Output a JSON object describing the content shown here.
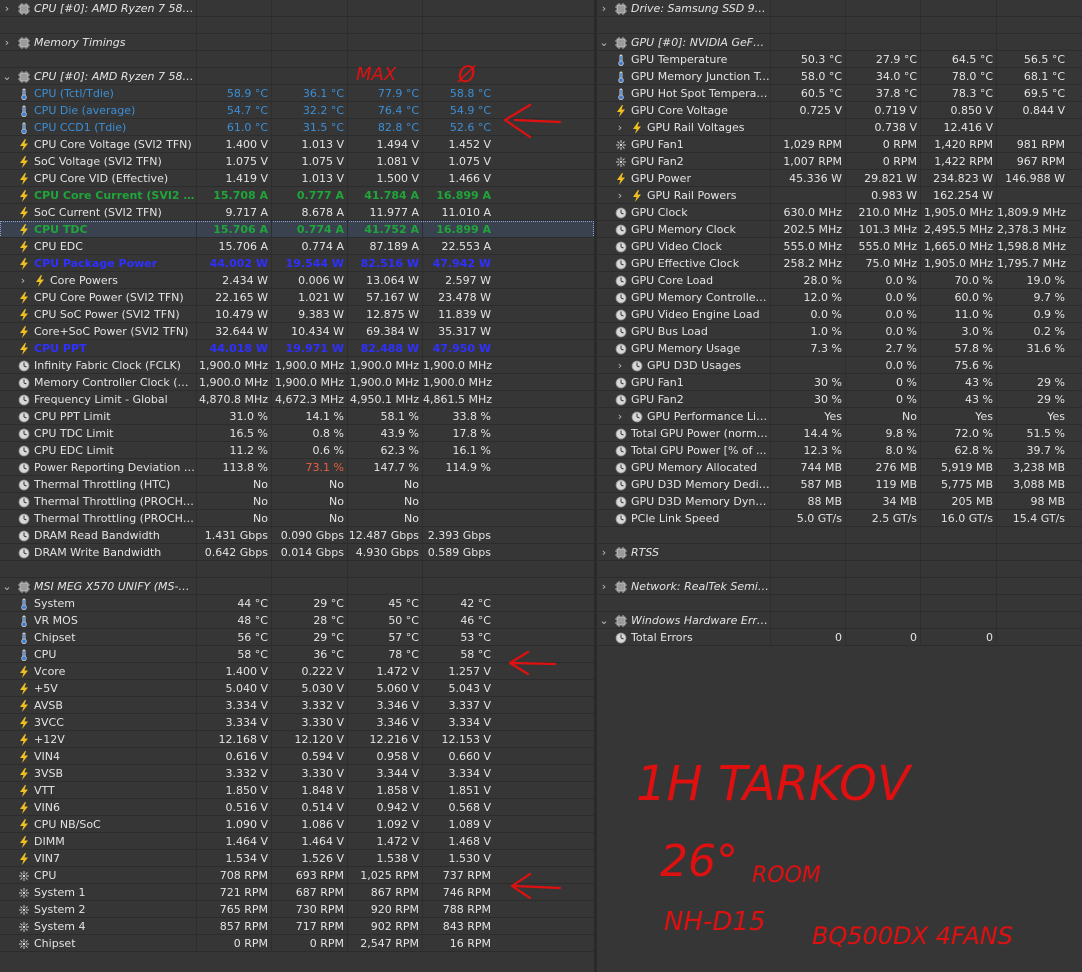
{
  "left": {
    "rows": [
      {
        "t": "grp",
        "exp": "›",
        "label": "CPU [#0]: AMD Ryzen 7 5800..."
      },
      {
        "t": "blank"
      },
      {
        "t": "grp",
        "exp": "›",
        "label": "Memory Timings"
      },
      {
        "t": "blank"
      },
      {
        "t": "grp",
        "exp": "⌄",
        "label": "CPU [#0]: AMD Ryzen 7 5800..."
      },
      {
        "t": "s",
        "i": "temp",
        "label": "CPU (Tctl/Tdie)",
        "v": [
          "58.9 °C",
          "36.1 °C",
          "77.9 °C",
          "58.8 °C"
        ],
        "cls": "t-blue"
      },
      {
        "t": "s",
        "i": "temp",
        "label": "CPU Die (average)",
        "v": [
          "54.7 °C",
          "32.2 °C",
          "76.4 °C",
          "54.9 °C"
        ],
        "cls": "t-blue"
      },
      {
        "t": "s",
        "i": "temp",
        "label": "CPU CCD1 (Tdie)",
        "v": [
          "61.0 °C",
          "31.5 °C",
          "82.8 °C",
          "52.6 °C"
        ],
        "cls": "t-blue"
      },
      {
        "t": "s",
        "i": "bolt",
        "label": "CPU Core Voltage (SVI2 TFN)",
        "v": [
          "1.400 V",
          "1.013 V",
          "1.494 V",
          "1.452 V"
        ]
      },
      {
        "t": "s",
        "i": "bolt",
        "label": "SoC Voltage (SVI2 TFN)",
        "v": [
          "1.075 V",
          "1.075 V",
          "1.081 V",
          "1.075 V"
        ]
      },
      {
        "t": "s",
        "i": "bolt",
        "label": "CPU Core VID (Effective)",
        "v": [
          "1.419 V",
          "1.013 V",
          "1.500 V",
          "1.466 V"
        ]
      },
      {
        "t": "s",
        "i": "bolt",
        "label": "CPU Core Current (SVI2 TFN)",
        "v": [
          "15.708 A",
          "0.777 A",
          "41.784 A",
          "16.899 A"
        ],
        "cls": "t-green"
      },
      {
        "t": "s",
        "i": "bolt",
        "label": "SoC Current (SVI2 TFN)",
        "v": [
          "9.717 A",
          "8.678 A",
          "11.977 A",
          "11.010 A"
        ]
      },
      {
        "t": "s",
        "i": "bolt",
        "label": "CPU TDC",
        "v": [
          "15.706 A",
          "0.774 A",
          "41.752 A",
          "16.899 A"
        ],
        "cls": "t-green",
        "sel": true
      },
      {
        "t": "s",
        "i": "bolt",
        "label": "CPU EDC",
        "v": [
          "15.706 A",
          "0.774 A",
          "87.189 A",
          "22.553 A"
        ]
      },
      {
        "t": "s",
        "i": "bolt",
        "label": "CPU Package Power",
        "v": [
          "44.002 W",
          "19.544 W",
          "82.516 W",
          "47.942 W"
        ],
        "cls": "t-navy"
      },
      {
        "t": "s",
        "exp": "›",
        "i": "bolt",
        "label": "Core Powers",
        "v": [
          "2.434 W",
          "0.006 W",
          "13.064 W",
          "2.597 W"
        ],
        "ind": 1
      },
      {
        "t": "s",
        "i": "bolt",
        "label": "CPU Core Power (SVI2 TFN)",
        "v": [
          "22.165 W",
          "1.021 W",
          "57.167 W",
          "23.478 W"
        ]
      },
      {
        "t": "s",
        "i": "bolt",
        "label": "CPU SoC Power (SVI2 TFN)",
        "v": [
          "10.479 W",
          "9.383 W",
          "12.875 W",
          "11.839 W"
        ]
      },
      {
        "t": "s",
        "i": "bolt",
        "label": "Core+SoC Power (SVI2 TFN)",
        "v": [
          "32.644 W",
          "10.434 W",
          "69.384 W",
          "35.317 W"
        ]
      },
      {
        "t": "s",
        "i": "bolt",
        "label": "CPU PPT",
        "v": [
          "44.018 W",
          "19.971 W",
          "82.488 W",
          "47.950 W"
        ],
        "cls": "t-navy"
      },
      {
        "t": "s",
        "i": "clock",
        "label": "Infinity Fabric Clock (FCLK)",
        "v": [
          "1,900.0 MHz",
          "1,900.0 MHz",
          "1,900.0 MHz",
          "1,900.0 MHz"
        ]
      },
      {
        "t": "s",
        "i": "clock",
        "label": "Memory Controller Clock (UCLK)",
        "v": [
          "1,900.0 MHz",
          "1,900.0 MHz",
          "1,900.0 MHz",
          "1,900.0 MHz"
        ]
      },
      {
        "t": "s",
        "i": "clock",
        "label": "Frequency Limit - Global",
        "v": [
          "4,870.8 MHz",
          "4,672.3 MHz",
          "4,950.1 MHz",
          "4,861.5 MHz"
        ]
      },
      {
        "t": "s",
        "i": "clock",
        "label": "CPU PPT Limit",
        "v": [
          "31.0 %",
          "14.1 %",
          "58.1 %",
          "33.8 %"
        ]
      },
      {
        "t": "s",
        "i": "clock",
        "label": "CPU TDC Limit",
        "v": [
          "16.5 %",
          "0.8 %",
          "43.9 %",
          "17.8 %"
        ]
      },
      {
        "t": "s",
        "i": "clock",
        "label": "CPU EDC Limit",
        "v": [
          "11.2 %",
          "0.6 %",
          "62.3 %",
          "16.1 %"
        ]
      },
      {
        "t": "s",
        "i": "clock",
        "label": "Power Reporting Deviation (Ac...",
        "v": [
          "113.8 %",
          "73.1 %",
          "147.7 %",
          "114.9 %"
        ],
        "redcol": 1
      },
      {
        "t": "s",
        "i": "clock",
        "label": "Thermal Throttling (HTC)",
        "v": [
          "No",
          "No",
          "No",
          ""
        ]
      },
      {
        "t": "s",
        "i": "clock",
        "label": "Thermal Throttling (PROCHOT ...",
        "v": [
          "No",
          "No",
          "No",
          ""
        ]
      },
      {
        "t": "s",
        "i": "clock",
        "label": "Thermal Throttling (PROCHOT ...",
        "v": [
          "No",
          "No",
          "No",
          ""
        ]
      },
      {
        "t": "s",
        "i": "clock",
        "label": "DRAM Read Bandwidth",
        "v": [
          "1.431 Gbps",
          "0.090 Gbps",
          "12.487 Gbps",
          "2.393 Gbps"
        ]
      },
      {
        "t": "s",
        "i": "clock",
        "label": "DRAM Write Bandwidth",
        "v": [
          "0.642 Gbps",
          "0.014 Gbps",
          "4.930 Gbps",
          "0.589 Gbps"
        ]
      },
      {
        "t": "blank"
      },
      {
        "t": "grp",
        "exp": "⌄",
        "label": "MSI MEG X570 UNIFY (MS-7C3..."
      },
      {
        "t": "s",
        "i": "temp",
        "label": "System",
        "v": [
          "44 °C",
          "29 °C",
          "45 °C",
          "42 °C"
        ]
      },
      {
        "t": "s",
        "i": "temp",
        "label": "VR MOS",
        "v": [
          "48 °C",
          "28 °C",
          "50 °C",
          "46 °C"
        ]
      },
      {
        "t": "s",
        "i": "temp",
        "label": "Chipset",
        "v": [
          "56 °C",
          "29 °C",
          "57 °C",
          "53 °C"
        ]
      },
      {
        "t": "s",
        "i": "temp",
        "label": "CPU",
        "v": [
          "58 °C",
          "36 °C",
          "78 °C",
          "58 °C"
        ]
      },
      {
        "t": "s",
        "i": "bolt",
        "label": "Vcore",
        "v": [
          "1.400 V",
          "0.222 V",
          "1.472 V",
          "1.257 V"
        ]
      },
      {
        "t": "s",
        "i": "bolt",
        "label": "+5V",
        "v": [
          "5.040 V",
          "5.030 V",
          "5.060 V",
          "5.043 V"
        ]
      },
      {
        "t": "s",
        "i": "bolt",
        "label": "AVSB",
        "v": [
          "3.334 V",
          "3.332 V",
          "3.346 V",
          "3.337 V"
        ]
      },
      {
        "t": "s",
        "i": "bolt",
        "label": "3VCC",
        "v": [
          "3.334 V",
          "3.330 V",
          "3.346 V",
          "3.334 V"
        ]
      },
      {
        "t": "s",
        "i": "bolt",
        "label": "+12V",
        "v": [
          "12.168 V",
          "12.120 V",
          "12.216 V",
          "12.153 V"
        ]
      },
      {
        "t": "s",
        "i": "bolt",
        "label": "VIN4",
        "v": [
          "0.616 V",
          "0.594 V",
          "0.958 V",
          "0.660 V"
        ]
      },
      {
        "t": "s",
        "i": "bolt",
        "label": "3VSB",
        "v": [
          "3.332 V",
          "3.330 V",
          "3.344 V",
          "3.334 V"
        ]
      },
      {
        "t": "s",
        "i": "bolt",
        "label": "VTT",
        "v": [
          "1.850 V",
          "1.848 V",
          "1.858 V",
          "1.851 V"
        ]
      },
      {
        "t": "s",
        "i": "bolt",
        "label": "VIN6",
        "v": [
          "0.516 V",
          "0.514 V",
          "0.942 V",
          "0.568 V"
        ]
      },
      {
        "t": "s",
        "i": "bolt",
        "label": "CPU NB/SoC",
        "v": [
          "1.090 V",
          "1.086 V",
          "1.092 V",
          "1.089 V"
        ]
      },
      {
        "t": "s",
        "i": "bolt",
        "label": "DIMM",
        "v": [
          "1.464 V",
          "1.464 V",
          "1.472 V",
          "1.468 V"
        ]
      },
      {
        "t": "s",
        "i": "bolt",
        "label": "VIN7",
        "v": [
          "1.534 V",
          "1.526 V",
          "1.538 V",
          "1.530 V"
        ]
      },
      {
        "t": "s",
        "i": "fan",
        "label": "CPU",
        "v": [
          "708 RPM",
          "693 RPM",
          "1,025 RPM",
          "737 RPM"
        ]
      },
      {
        "t": "s",
        "i": "fan",
        "label": "System 1",
        "v": [
          "721 RPM",
          "687 RPM",
          "867 RPM",
          "746 RPM"
        ]
      },
      {
        "t": "s",
        "i": "fan",
        "label": "System 2",
        "v": [
          "765 RPM",
          "730 RPM",
          "920 RPM",
          "788 RPM"
        ]
      },
      {
        "t": "s",
        "i": "fan",
        "label": "System 4",
        "v": [
          "857 RPM",
          "717 RPM",
          "902 RPM",
          "843 RPM"
        ]
      },
      {
        "t": "s",
        "i": "fan",
        "label": "Chipset",
        "v": [
          "0 RPM",
          "0 RPM",
          "2,547 RPM",
          "16 RPM"
        ]
      }
    ]
  },
  "right": {
    "rows": [
      {
        "t": "grp",
        "exp": "›",
        "label": "Drive: Samsung SSD 970..."
      },
      {
        "t": "blank"
      },
      {
        "t": "grp",
        "exp": "⌄",
        "label": "GPU [#0]: NVIDIA GeFor..."
      },
      {
        "t": "s",
        "i": "temp",
        "label": "GPU Temperature",
        "v": [
          "50.3 °C",
          "27.9 °C",
          "64.5 °C",
          "56.5 °C"
        ]
      },
      {
        "t": "s",
        "i": "temp",
        "label": "GPU Memory Junction Te...",
        "v": [
          "58.0 °C",
          "34.0 °C",
          "78.0 °C",
          "68.1 °C"
        ]
      },
      {
        "t": "s",
        "i": "temp",
        "label": "GPU Hot Spot Temperature",
        "v": [
          "60.5 °C",
          "37.8 °C",
          "78.3 °C",
          "69.5 °C"
        ]
      },
      {
        "t": "s",
        "i": "bolt",
        "label": "GPU Core Voltage",
        "v": [
          "0.725 V",
          "0.719 V",
          "0.850 V",
          "0.844 V"
        ]
      },
      {
        "t": "s",
        "exp": "›",
        "i": "bolt",
        "label": "GPU Rail Voltages",
        "v": [
          "",
          "0.738 V",
          "12.416 V",
          ""
        ],
        "ind": 1
      },
      {
        "t": "s",
        "i": "fan",
        "label": "GPU Fan1",
        "v": [
          "1,029 RPM",
          "0 RPM",
          "1,420 RPM",
          "981 RPM"
        ]
      },
      {
        "t": "s",
        "i": "fan",
        "label": "GPU Fan2",
        "v": [
          "1,007 RPM",
          "0 RPM",
          "1,422 RPM",
          "967 RPM"
        ]
      },
      {
        "t": "s",
        "i": "bolt",
        "label": "GPU Power",
        "v": [
          "45.336 W",
          "29.821 W",
          "234.823 W",
          "146.988 W"
        ]
      },
      {
        "t": "s",
        "exp": "›",
        "i": "bolt",
        "label": "GPU Rail Powers",
        "v": [
          "",
          "0.983 W",
          "162.254 W",
          ""
        ],
        "ind": 1
      },
      {
        "t": "s",
        "i": "clock",
        "label": "GPU Clock",
        "v": [
          "630.0 MHz",
          "210.0 MHz",
          "1,905.0 MHz",
          "1,809.9 MHz"
        ]
      },
      {
        "t": "s",
        "i": "clock",
        "label": "GPU Memory Clock",
        "v": [
          "202.5 MHz",
          "101.3 MHz",
          "2,495.5 MHz",
          "2,378.3 MHz"
        ]
      },
      {
        "t": "s",
        "i": "clock",
        "label": "GPU Video Clock",
        "v": [
          "555.0 MHz",
          "555.0 MHz",
          "1,665.0 MHz",
          "1,598.8 MHz"
        ]
      },
      {
        "t": "s",
        "i": "clock",
        "label": "GPU Effective Clock",
        "v": [
          "258.2 MHz",
          "75.0 MHz",
          "1,905.0 MHz",
          "1,795.7 MHz"
        ]
      },
      {
        "t": "s",
        "i": "clock",
        "label": "GPU Core Load",
        "v": [
          "28.0 %",
          "0.0 %",
          "70.0 %",
          "19.0 %"
        ]
      },
      {
        "t": "s",
        "i": "clock",
        "label": "GPU Memory Controller L...",
        "v": [
          "12.0 %",
          "0.0 %",
          "60.0 %",
          "9.7 %"
        ]
      },
      {
        "t": "s",
        "i": "clock",
        "label": "GPU Video Engine Load",
        "v": [
          "0.0 %",
          "0.0 %",
          "11.0 %",
          "0.9 %"
        ]
      },
      {
        "t": "s",
        "i": "clock",
        "label": "GPU Bus Load",
        "v": [
          "1.0 %",
          "0.0 %",
          "3.0 %",
          "0.2 %"
        ]
      },
      {
        "t": "s",
        "i": "clock",
        "label": "GPU Memory Usage",
        "v": [
          "7.3 %",
          "2.7 %",
          "57.8 %",
          "31.6 %"
        ]
      },
      {
        "t": "s",
        "exp": "›",
        "i": "clock",
        "label": "GPU D3D Usages",
        "v": [
          "",
          "0.0 %",
          "75.6 %",
          ""
        ],
        "ind": 1
      },
      {
        "t": "s",
        "i": "clock",
        "label": "GPU Fan1",
        "v": [
          "30 %",
          "0 %",
          "43 %",
          "29 %"
        ]
      },
      {
        "t": "s",
        "i": "clock",
        "label": "GPU Fan2",
        "v": [
          "30 %",
          "0 %",
          "43 %",
          "29 %"
        ]
      },
      {
        "t": "s",
        "exp": "›",
        "i": "clock",
        "label": "GPU Performance Limits",
        "v": [
          "Yes",
          "No",
          "Yes",
          "Yes"
        ],
        "ind": 1
      },
      {
        "t": "s",
        "i": "clock",
        "label": "Total GPU Power (normal...",
        "v": [
          "14.4 %",
          "9.8 %",
          "72.0 %",
          "51.5 %"
        ]
      },
      {
        "t": "s",
        "i": "clock",
        "label": "Total GPU Power [% of ...",
        "v": [
          "12.3 %",
          "8.0 %",
          "62.8 %",
          "39.7 %"
        ]
      },
      {
        "t": "s",
        "i": "clock",
        "label": "GPU Memory Allocated",
        "v": [
          "744 MB",
          "276 MB",
          "5,919 MB",
          "3,238 MB"
        ]
      },
      {
        "t": "s",
        "i": "clock",
        "label": "GPU D3D Memory Dedica...",
        "v": [
          "587 MB",
          "119 MB",
          "5,775 MB",
          "3,088 MB"
        ]
      },
      {
        "t": "s",
        "i": "clock",
        "label": "GPU D3D Memory Dynamic",
        "v": [
          "88 MB",
          "34 MB",
          "205 MB",
          "98 MB"
        ]
      },
      {
        "t": "s",
        "i": "clock",
        "label": "PCIe Link Speed",
        "v": [
          "5.0 GT/s",
          "2.5 GT/s",
          "16.0 GT/s",
          "15.4 GT/s"
        ]
      },
      {
        "t": "blank"
      },
      {
        "t": "grp",
        "exp": "›",
        "label": "RTSS"
      },
      {
        "t": "blank"
      },
      {
        "t": "grp",
        "exp": "›",
        "label": "Network: RealTek Semic..."
      },
      {
        "t": "blank"
      },
      {
        "t": "grp",
        "exp": "⌄",
        "label": "Windows Hardware Erro..."
      },
      {
        "t": "s",
        "i": "clock",
        "label": "Total Errors",
        "v": [
          "0",
          "0",
          "0",
          ""
        ]
      }
    ]
  },
  "annotations": {
    "max_note": "MAX",
    "avg_note": "Ø",
    "note_line1": "1H TARKOV",
    "note_line2": "26°",
    "note_line3": "ROOM",
    "note_line4": "NH-D15",
    "note_line5": "BQ500DX 4FANS",
    "ink_color": "#e01010"
  },
  "colors": {
    "panel": "#363636",
    "blue": "#3b8fd6",
    "green": "#1fa53a",
    "navy": "#2f2fff",
    "red": "#e86040"
  }
}
